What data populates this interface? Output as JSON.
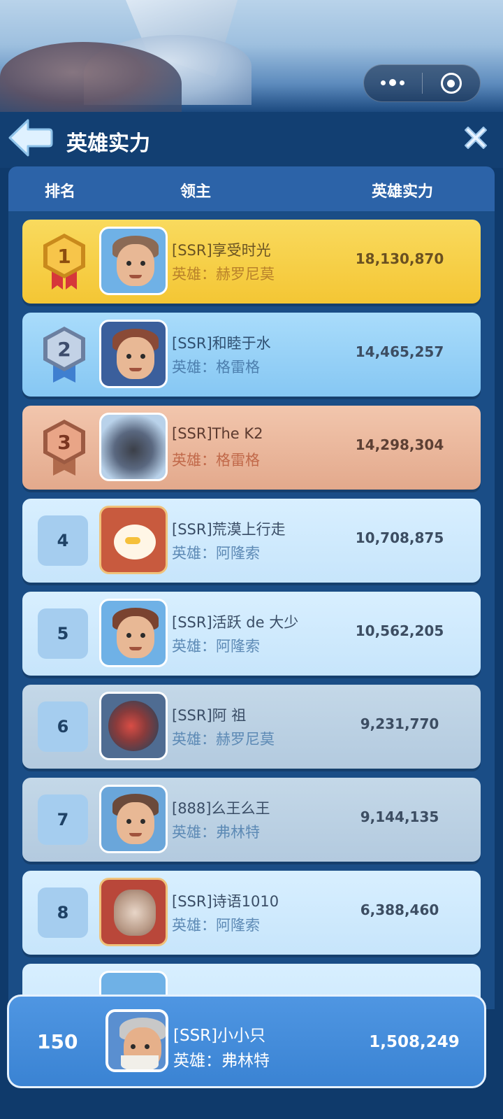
{
  "header": {
    "title": "英雄实力"
  },
  "columns": {
    "rank": "排名",
    "lord": "领主",
    "power": "英雄实力"
  },
  "rows": [
    {
      "rank": "1",
      "name": "[SSR]享受时光",
      "hero": "英雄：赫罗尼莫",
      "power": "18,130,870"
    },
    {
      "rank": "2",
      "name": "[SSR]和睦于水",
      "hero": "英雄：格雷格",
      "power": "14,465,257"
    },
    {
      "rank": "3",
      "name": "[SSR]The K2",
      "hero": "英雄：格雷格",
      "power": "14,298,304"
    },
    {
      "rank": "4",
      "name": "[SSR]荒漠上行走",
      "hero": "英雄：阿隆索",
      "power": "10,708,875"
    },
    {
      "rank": "5",
      "name": "[SSR]活跃 de 大少",
      "hero": "英雄：阿隆索",
      "power": "10,562,205"
    },
    {
      "rank": "6",
      "name": "[SSR]阿 祖",
      "hero": "英雄：赫罗尼莫",
      "power": "9,231,770"
    },
    {
      "rank": "7",
      "name": "[888]么王么王",
      "hero": "英雄：弗林特",
      "power": "9,144,135"
    },
    {
      "rank": "8",
      "name": "[SSR]诗语1010",
      "hero": "英雄：阿隆索",
      "power": "6,388,460"
    }
  ],
  "self": {
    "rank": "150",
    "name": "[SSR]小小只",
    "hero": "英雄：弗林特",
    "power": "1,508,249"
  },
  "colors": {
    "gold": "#f4c634",
    "silver": "#86c7f3",
    "bronze": "#e3a98c",
    "row_blue": "#c7e5fb",
    "row_grey": "#b3cadf",
    "self_row": "#3a83d3"
  },
  "icons": {
    "back": "back-arrow-icon",
    "close": "close-x-icon",
    "menu": "more-dots-icon",
    "target": "target-circle-icon",
    "medal1": "gold-medal-icon",
    "medal2": "silver-medal-icon",
    "medal3": "bronze-medal-icon"
  }
}
